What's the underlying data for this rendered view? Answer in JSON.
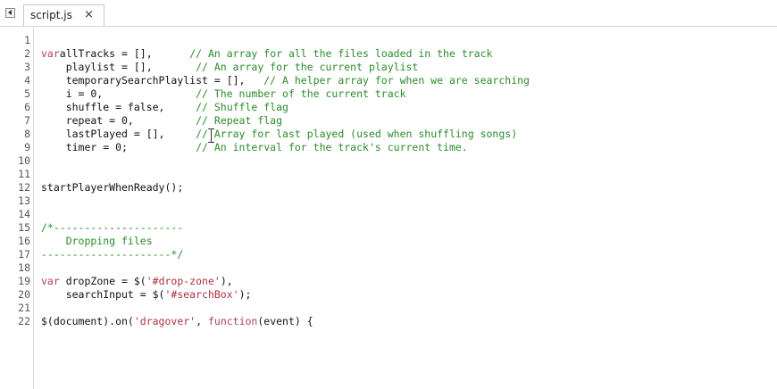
{
  "tab": {
    "label": "script.js",
    "close": "×"
  },
  "lines": [
    {
      "n": "1",
      "parts": []
    },
    {
      "n": "2",
      "parts": [
        [
          "kw",
          "var"
        ],
        [
          "",
          "allTracks = [],      "
        ],
        [
          "cm",
          "// An array for all the files loaded in the track"
        ]
      ]
    },
    {
      "n": "3",
      "parts": [
        [
          "",
          "    playlist = [],       "
        ],
        [
          "cm",
          "// An array for the current playlist"
        ]
      ]
    },
    {
      "n": "4",
      "parts": [
        [
          "",
          "    temporarySearchPlaylist = [],   "
        ],
        [
          "cm",
          "// A helper array for when we are searching"
        ]
      ]
    },
    {
      "n": "5",
      "parts": [
        [
          "",
          "    i = 0,               "
        ],
        [
          "cm",
          "// The number of the current track"
        ]
      ]
    },
    {
      "n": "6",
      "parts": [
        [
          "",
          "    shuffle = false,     "
        ],
        [
          "cm",
          "// Shuffle flag"
        ]
      ]
    },
    {
      "n": "7",
      "parts": [
        [
          "",
          "    repeat = 0,          "
        ],
        [
          "cm",
          "// Repeat flag"
        ]
      ]
    },
    {
      "n": "8",
      "parts": [
        [
          "",
          "    lastPlayed = [],     "
        ],
        [
          "cm",
          "// Array for last played (used when shuffling songs)"
        ]
      ]
    },
    {
      "n": "9",
      "parts": [
        [
          "",
          "    timer = 0;           "
        ],
        [
          "cm",
          "// An interval for the track's current time."
        ]
      ]
    },
    {
      "n": "10",
      "parts": []
    },
    {
      "n": "11",
      "parts": []
    },
    {
      "n": "12",
      "parts": [
        [
          "",
          "startPlayerWhenReady();"
        ]
      ]
    },
    {
      "n": "13",
      "parts": []
    },
    {
      "n": "14",
      "parts": []
    },
    {
      "n": "15",
      "parts": [
        [
          "cm",
          "/*---------------------"
        ]
      ]
    },
    {
      "n": "16",
      "parts": [
        [
          "cm",
          "    Dropping files"
        ]
      ]
    },
    {
      "n": "17",
      "parts": [
        [
          "cm",
          "---------------------*/"
        ]
      ]
    },
    {
      "n": "18",
      "parts": []
    },
    {
      "n": "19",
      "parts": [
        [
          "kw",
          "var"
        ],
        [
          "",
          " dropZone = $("
        ],
        [
          "st",
          "'#drop-zone'"
        ],
        [
          "",
          "),"
        ]
      ]
    },
    {
      "n": "20",
      "parts": [
        [
          "",
          "    searchInput = $("
        ],
        [
          "st",
          "'#searchBox'"
        ],
        [
          "",
          ");"
        ]
      ]
    },
    {
      "n": "21",
      "parts": []
    },
    {
      "n": "22",
      "parts": [
        [
          "",
          "$(document).on("
        ],
        [
          "st",
          "'dragover'"
        ],
        [
          "",
          ", "
        ],
        [
          "kw",
          "function"
        ],
        [
          "",
          "(event) {"
        ]
      ]
    }
  ]
}
